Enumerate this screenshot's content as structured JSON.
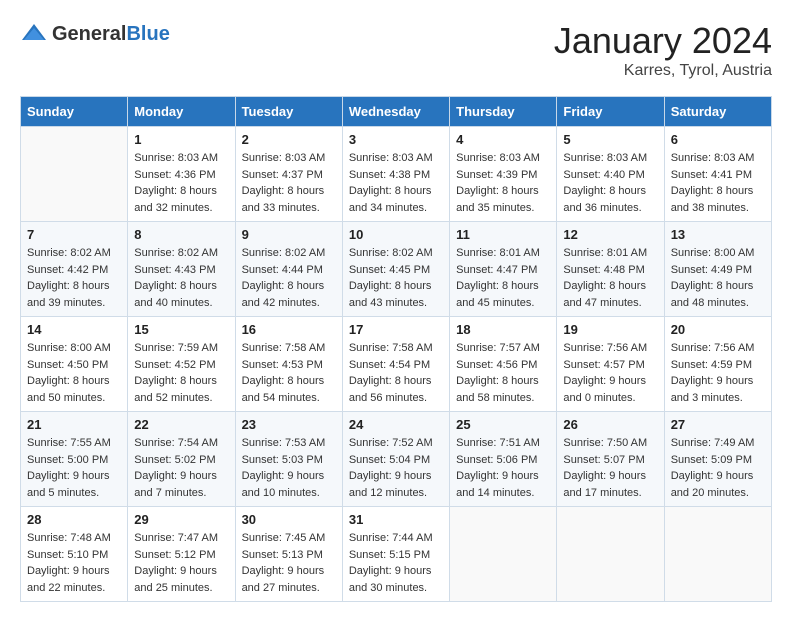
{
  "header": {
    "logo_general": "General",
    "logo_blue": "Blue",
    "title": "January 2024",
    "location": "Karres, Tyrol, Austria"
  },
  "columns": [
    "Sunday",
    "Monday",
    "Tuesday",
    "Wednesday",
    "Thursday",
    "Friday",
    "Saturday"
  ],
  "weeks": [
    [
      {
        "day": "",
        "sunrise": "",
        "sunset": "",
        "daylight": ""
      },
      {
        "day": "1",
        "sunrise": "Sunrise: 8:03 AM",
        "sunset": "Sunset: 4:36 PM",
        "daylight": "Daylight: 8 hours and 32 minutes."
      },
      {
        "day": "2",
        "sunrise": "Sunrise: 8:03 AM",
        "sunset": "Sunset: 4:37 PM",
        "daylight": "Daylight: 8 hours and 33 minutes."
      },
      {
        "day": "3",
        "sunrise": "Sunrise: 8:03 AM",
        "sunset": "Sunset: 4:38 PM",
        "daylight": "Daylight: 8 hours and 34 minutes."
      },
      {
        "day": "4",
        "sunrise": "Sunrise: 8:03 AM",
        "sunset": "Sunset: 4:39 PM",
        "daylight": "Daylight: 8 hours and 35 minutes."
      },
      {
        "day": "5",
        "sunrise": "Sunrise: 8:03 AM",
        "sunset": "Sunset: 4:40 PM",
        "daylight": "Daylight: 8 hours and 36 minutes."
      },
      {
        "day": "6",
        "sunrise": "Sunrise: 8:03 AM",
        "sunset": "Sunset: 4:41 PM",
        "daylight": "Daylight: 8 hours and 38 minutes."
      }
    ],
    [
      {
        "day": "7",
        "sunrise": "Sunrise: 8:02 AM",
        "sunset": "Sunset: 4:42 PM",
        "daylight": "Daylight: 8 hours and 39 minutes."
      },
      {
        "day": "8",
        "sunrise": "Sunrise: 8:02 AM",
        "sunset": "Sunset: 4:43 PM",
        "daylight": "Daylight: 8 hours and 40 minutes."
      },
      {
        "day": "9",
        "sunrise": "Sunrise: 8:02 AM",
        "sunset": "Sunset: 4:44 PM",
        "daylight": "Daylight: 8 hours and 42 minutes."
      },
      {
        "day": "10",
        "sunrise": "Sunrise: 8:02 AM",
        "sunset": "Sunset: 4:45 PM",
        "daylight": "Daylight: 8 hours and 43 minutes."
      },
      {
        "day": "11",
        "sunrise": "Sunrise: 8:01 AM",
        "sunset": "Sunset: 4:47 PM",
        "daylight": "Daylight: 8 hours and 45 minutes."
      },
      {
        "day": "12",
        "sunrise": "Sunrise: 8:01 AM",
        "sunset": "Sunset: 4:48 PM",
        "daylight": "Daylight: 8 hours and 47 minutes."
      },
      {
        "day": "13",
        "sunrise": "Sunrise: 8:00 AM",
        "sunset": "Sunset: 4:49 PM",
        "daylight": "Daylight: 8 hours and 48 minutes."
      }
    ],
    [
      {
        "day": "14",
        "sunrise": "Sunrise: 8:00 AM",
        "sunset": "Sunset: 4:50 PM",
        "daylight": "Daylight: 8 hours and 50 minutes."
      },
      {
        "day": "15",
        "sunrise": "Sunrise: 7:59 AM",
        "sunset": "Sunset: 4:52 PM",
        "daylight": "Daylight: 8 hours and 52 minutes."
      },
      {
        "day": "16",
        "sunrise": "Sunrise: 7:58 AM",
        "sunset": "Sunset: 4:53 PM",
        "daylight": "Daylight: 8 hours and 54 minutes."
      },
      {
        "day": "17",
        "sunrise": "Sunrise: 7:58 AM",
        "sunset": "Sunset: 4:54 PM",
        "daylight": "Daylight: 8 hours and 56 minutes."
      },
      {
        "day": "18",
        "sunrise": "Sunrise: 7:57 AM",
        "sunset": "Sunset: 4:56 PM",
        "daylight": "Daylight: 8 hours and 58 minutes."
      },
      {
        "day": "19",
        "sunrise": "Sunrise: 7:56 AM",
        "sunset": "Sunset: 4:57 PM",
        "daylight": "Daylight: 9 hours and 0 minutes."
      },
      {
        "day": "20",
        "sunrise": "Sunrise: 7:56 AM",
        "sunset": "Sunset: 4:59 PM",
        "daylight": "Daylight: 9 hours and 3 minutes."
      }
    ],
    [
      {
        "day": "21",
        "sunrise": "Sunrise: 7:55 AM",
        "sunset": "Sunset: 5:00 PM",
        "daylight": "Daylight: 9 hours and 5 minutes."
      },
      {
        "day": "22",
        "sunrise": "Sunrise: 7:54 AM",
        "sunset": "Sunset: 5:02 PM",
        "daylight": "Daylight: 9 hours and 7 minutes."
      },
      {
        "day": "23",
        "sunrise": "Sunrise: 7:53 AM",
        "sunset": "Sunset: 5:03 PM",
        "daylight": "Daylight: 9 hours and 10 minutes."
      },
      {
        "day": "24",
        "sunrise": "Sunrise: 7:52 AM",
        "sunset": "Sunset: 5:04 PM",
        "daylight": "Daylight: 9 hours and 12 minutes."
      },
      {
        "day": "25",
        "sunrise": "Sunrise: 7:51 AM",
        "sunset": "Sunset: 5:06 PM",
        "daylight": "Daylight: 9 hours and 14 minutes."
      },
      {
        "day": "26",
        "sunrise": "Sunrise: 7:50 AM",
        "sunset": "Sunset: 5:07 PM",
        "daylight": "Daylight: 9 hours and 17 minutes."
      },
      {
        "day": "27",
        "sunrise": "Sunrise: 7:49 AM",
        "sunset": "Sunset: 5:09 PM",
        "daylight": "Daylight: 9 hours and 20 minutes."
      }
    ],
    [
      {
        "day": "28",
        "sunrise": "Sunrise: 7:48 AM",
        "sunset": "Sunset: 5:10 PM",
        "daylight": "Daylight: 9 hours and 22 minutes."
      },
      {
        "day": "29",
        "sunrise": "Sunrise: 7:47 AM",
        "sunset": "Sunset: 5:12 PM",
        "daylight": "Daylight: 9 hours and 25 minutes."
      },
      {
        "day": "30",
        "sunrise": "Sunrise: 7:45 AM",
        "sunset": "Sunset: 5:13 PM",
        "daylight": "Daylight: 9 hours and 27 minutes."
      },
      {
        "day": "31",
        "sunrise": "Sunrise: 7:44 AM",
        "sunset": "Sunset: 5:15 PM",
        "daylight": "Daylight: 9 hours and 30 minutes."
      },
      {
        "day": "",
        "sunrise": "",
        "sunset": "",
        "daylight": ""
      },
      {
        "day": "",
        "sunrise": "",
        "sunset": "",
        "daylight": ""
      },
      {
        "day": "",
        "sunrise": "",
        "sunset": "",
        "daylight": ""
      }
    ]
  ]
}
